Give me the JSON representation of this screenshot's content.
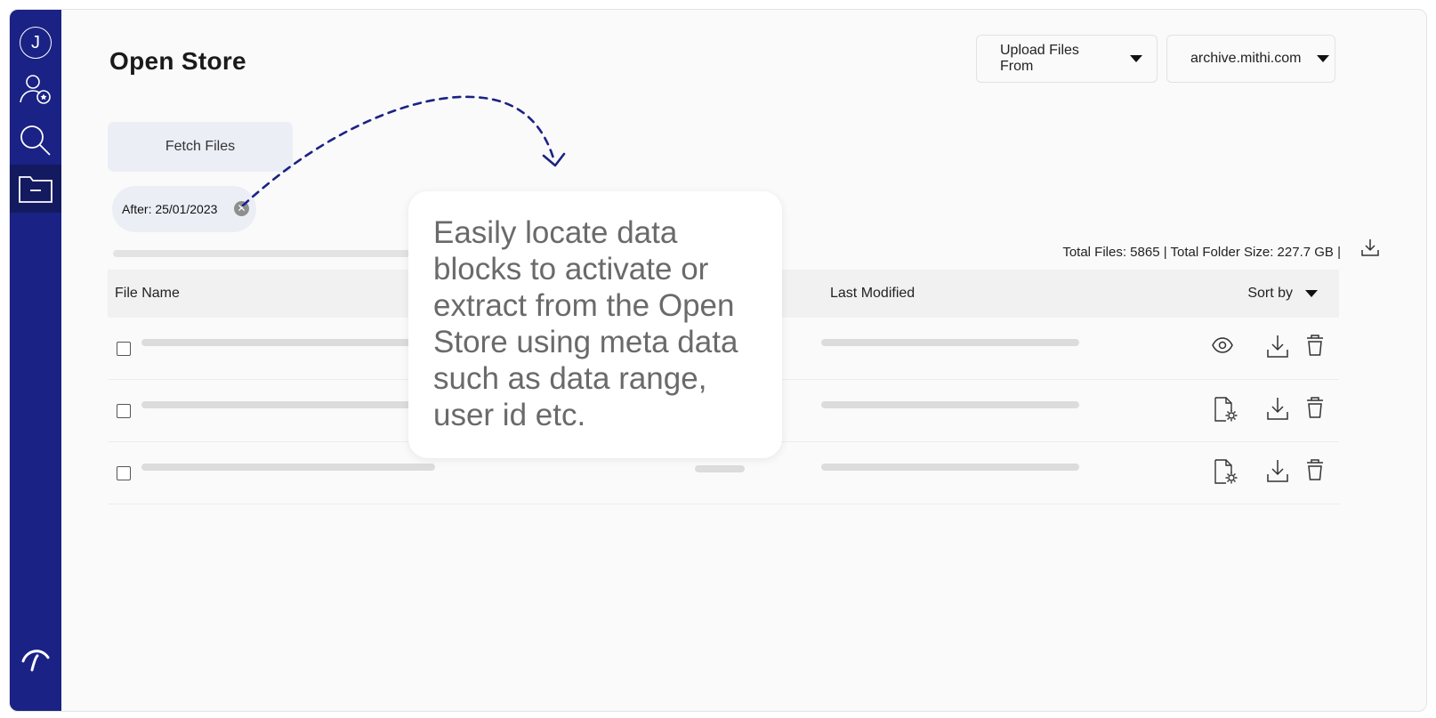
{
  "sidebar": {
    "avatar_initial": "J",
    "items": [
      {
        "name": "user-profile"
      },
      {
        "name": "search"
      },
      {
        "name": "open-store",
        "active": true
      }
    ]
  },
  "header": {
    "title": "Open Store",
    "upload_dropdown": "Upload Files From",
    "domain_dropdown": "archive.mithi.com"
  },
  "filters": {
    "fetch_button": "Fetch Files",
    "chip_label": "After: 25/01/2023"
  },
  "summary": {
    "text": "Total Files: 5865 | Total Folder Size: 227.7 GB |"
  },
  "table": {
    "columns": [
      "File Name",
      "Last Modified"
    ],
    "sort_label": "Sort by",
    "rows": [
      {
        "actions": [
          "view-icon",
          "download-icon",
          "delete-icon"
        ]
      },
      {
        "actions": [
          "file-settings-icon",
          "download-icon",
          "delete-icon"
        ]
      },
      {
        "actions": [
          "file-settings-icon",
          "download-icon",
          "delete-icon"
        ]
      }
    ]
  },
  "tooltip": {
    "text": "Easily locate data blocks to activate or extract from the Open Store using meta data such as data range, user id etc."
  },
  "colors": {
    "sidebar": "#1a2285",
    "sidebar_active": "#131a60",
    "accent_curve": "#1a2285"
  }
}
